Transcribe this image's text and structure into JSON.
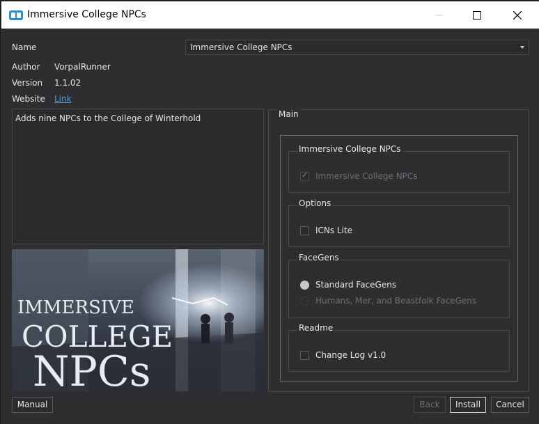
{
  "window": {
    "title": "Immersive College NPCs"
  },
  "info": {
    "name_label": "Name",
    "name_value": "Immersive College NPCs",
    "author_label": "Author",
    "author_value": "VorpalRunner",
    "version_label": "Version",
    "version_value": "1.1.02",
    "website_label": "Website",
    "website_link": "Link",
    "description": "Adds nine NPCs to the College of Winterhold"
  },
  "banner": {
    "line1": "IMMERSIVE",
    "line2": "COLLEGE",
    "line3": "NPCs"
  },
  "main": {
    "title": "Main",
    "groups": [
      {
        "title": "Immersive College NPCs",
        "options": [
          {
            "label": "Immersive College NPCs",
            "type": "checkbox",
            "checked": true,
            "disabled": true
          }
        ]
      },
      {
        "title": "Options",
        "options": [
          {
            "label": "ICNs Lite",
            "type": "checkbox",
            "checked": false,
            "disabled": false
          }
        ]
      },
      {
        "title": "FaceGens",
        "options": [
          {
            "label": "Standard FaceGens",
            "type": "radio",
            "checked": true,
            "disabled": false
          },
          {
            "label": "Humans, Mer, and Beastfolk FaceGens",
            "type": "radio",
            "checked": false,
            "disabled": true
          }
        ]
      },
      {
        "title": "Readme",
        "options": [
          {
            "label": "Change Log v1.0",
            "type": "checkbox",
            "checked": false,
            "disabled": false
          }
        ]
      }
    ]
  },
  "buttons": {
    "manual": "Manual",
    "back": "Back",
    "install": "Install",
    "cancel": "Cancel"
  },
  "colors": {
    "background": "#2e2e30",
    "link": "#4a9fe8",
    "titlebar": "#ffffff"
  }
}
